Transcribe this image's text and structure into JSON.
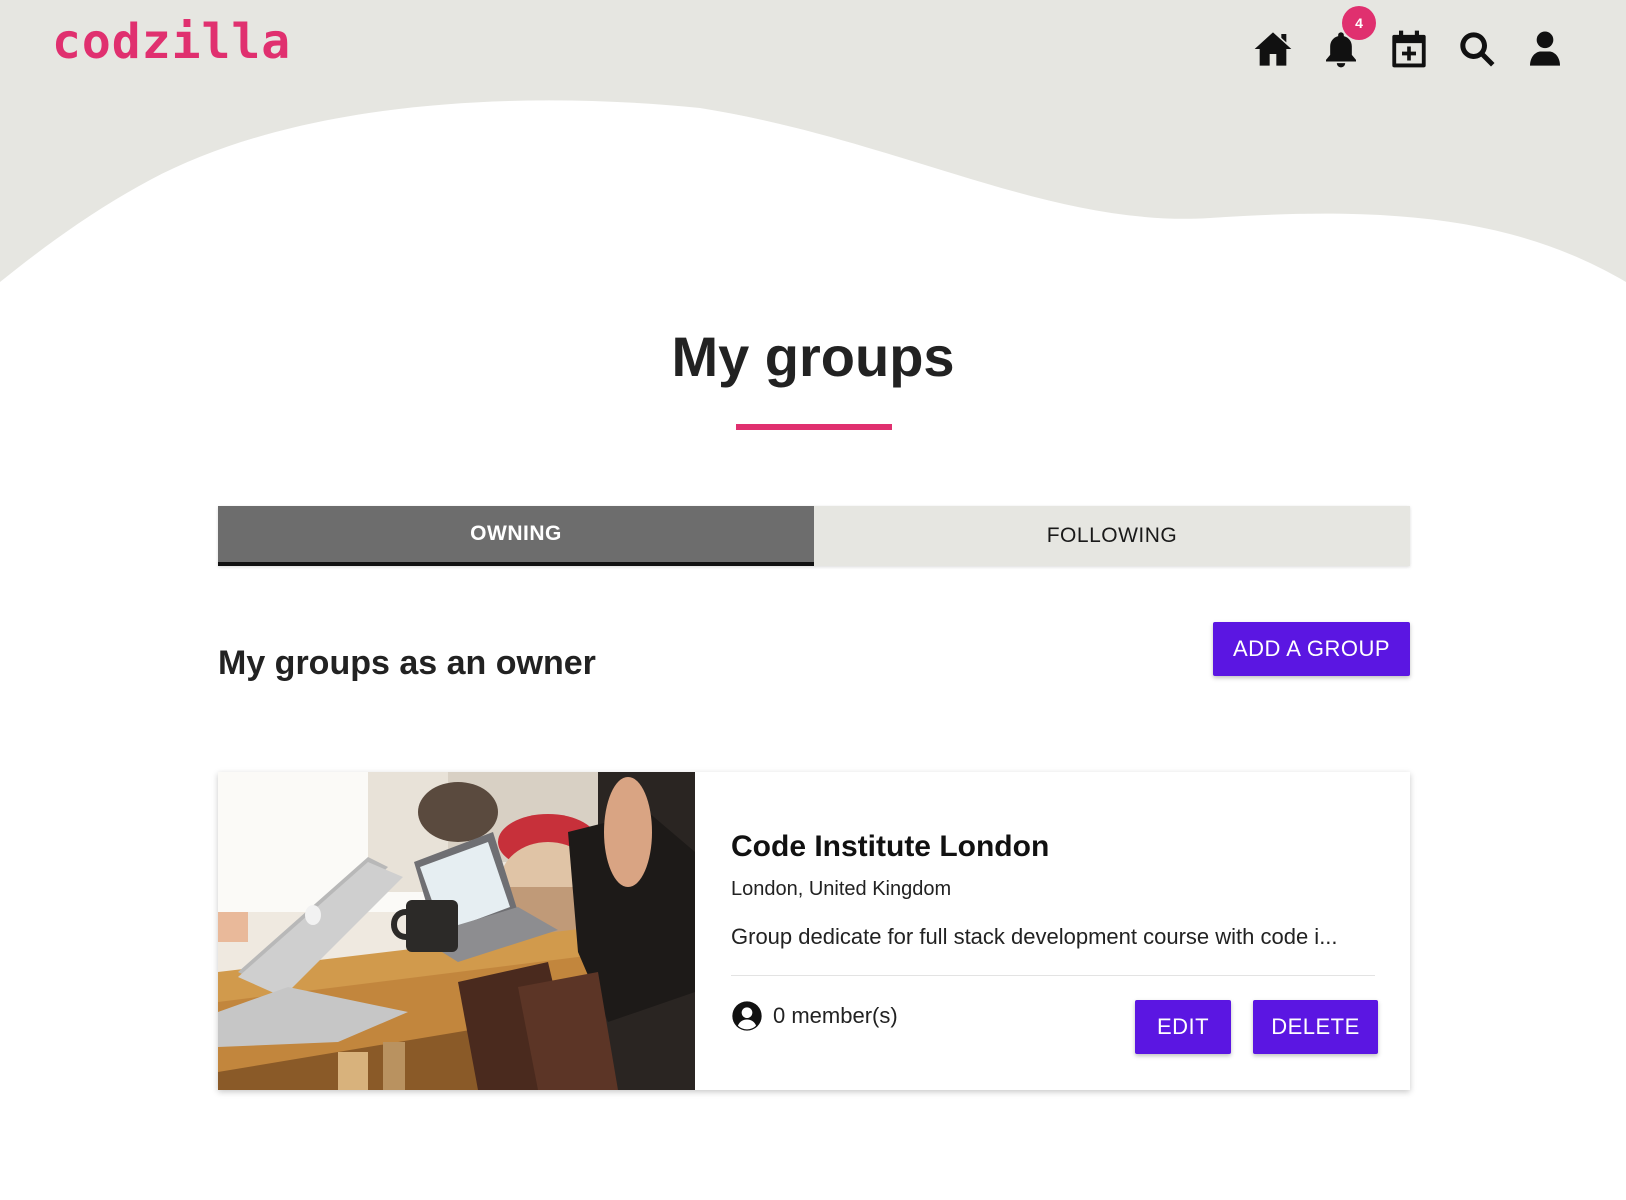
{
  "header": {
    "logo": "codzilla",
    "nav": {
      "home_icon": "home-icon",
      "notifications_icon": "bell-icon",
      "notifications_count": "4",
      "add_event_icon": "calendar-plus-icon",
      "search_icon": "search-icon",
      "profile_icon": "user-icon"
    }
  },
  "page": {
    "title": "My groups"
  },
  "tabs": [
    {
      "label": "OWNING",
      "active": true
    },
    {
      "label": "FOLLOWING",
      "active": false
    }
  ],
  "section": {
    "title": "My groups as an owner",
    "add_button": "ADD A GROUP"
  },
  "groups": [
    {
      "name": "Code Institute London",
      "location": "London, United Kingdom",
      "description": "Group dedicate for full stack development course with code i...",
      "members": "0 member(s)",
      "edit_label": "EDIT",
      "delete_label": "DELETE"
    }
  ],
  "colors": {
    "brand": "#e0306f",
    "primary_button": "#5b16e2",
    "header_bg": "#e6e6e1",
    "active_tab": "#6d6d6d"
  }
}
